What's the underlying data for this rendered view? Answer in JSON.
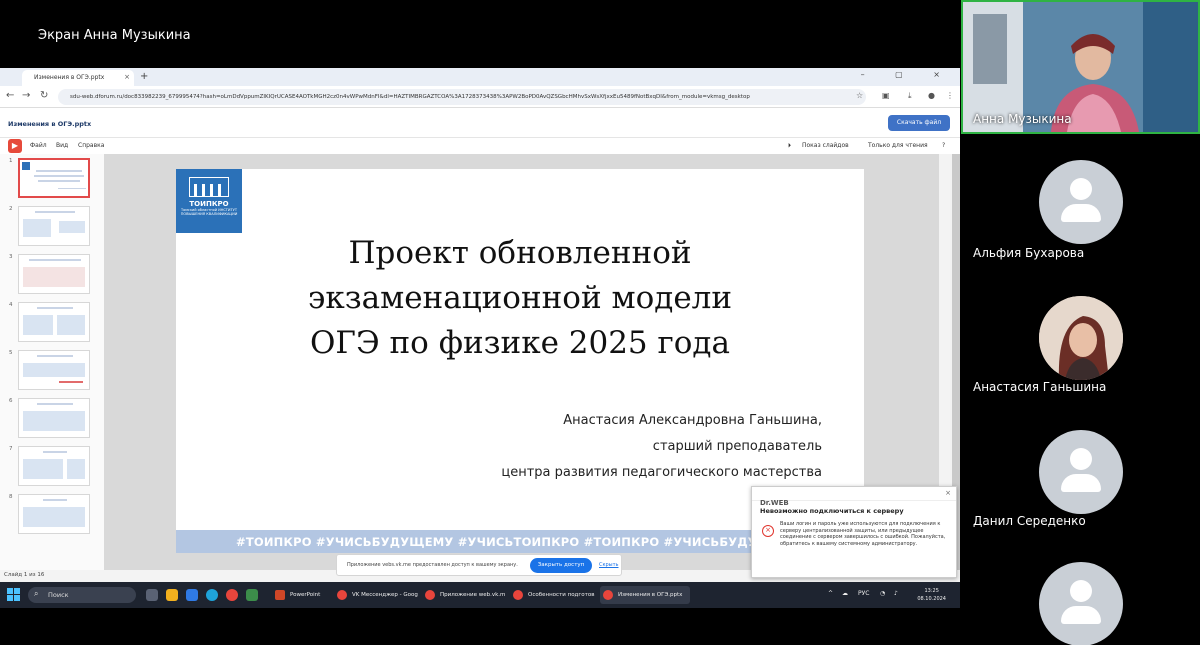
{
  "meeting": {
    "screen_title": "Экран Анна Музыкина"
  },
  "browser": {
    "tab_title": "Изменения в ОГЭ.pptx",
    "tab_close": "×",
    "new_tab": "+",
    "window_controls": "– ▢ ×",
    "url": "sdu-web.dforum.ru/doc833982239_679995474?hash=oLmDdVppumZIKIQrUCASE4AOTkMGH2cz0n4vWPwMdnFI&dl=HAZTIMBRGAZTCOA%3A1728373438%3APW2BoPD0AvQZSGbcHMhvSxWsXfjxxEu5489fNotBxqDI&from_module=vkmsg_desktop"
  },
  "doc": {
    "name": "Изменения в ОГЭ.pptx",
    "download_label": "Скачать файл",
    "menu": [
      "Файл",
      "Вид",
      "Справка"
    ],
    "slideshow_label": "Показ слайдов",
    "readonly_label": "Только для чтения",
    "status": "Слайд 1 из 16",
    "thumb_numbers": [
      "1",
      "2",
      "3",
      "4",
      "5",
      "6",
      "7",
      "8"
    ]
  },
  "slide": {
    "logo_title": "ТОИПКРО",
    "logo_sub": "Томский областной ИНСТИТУТ ПОВЫШЕНИЯ КВАЛИФИКАЦИИ",
    "title_lines": [
      "Проект обновленной",
      "экзаменационной модели",
      "ОГЭ по физике 2025 года"
    ],
    "author_lines": [
      "Анастасия Александровна Ганьшина,",
      "старший преподаватель",
      "центра развития педагогического мастерства"
    ],
    "hashtags": "#ТОИПКРО  #УЧИСЬБУДУЩЕМУ  #УЧИСЬТОИПКРО  #ТОИПКРО  #УЧИСЬБУДУЩЕМУ  #УЧИСЬ"
  },
  "share_banner": {
    "text": "Приложение vebs.vk.me предоставлен доступ к вашему экрану.",
    "button": "Закрыть доступ",
    "hide": "Скрыть"
  },
  "drweb": {
    "brand": "Dr.WEB",
    "title": "Невозможно подключиться к серверу",
    "text": "Ваши логин и пароль уже используются для подключения к серверу централизованной защиты, или предыдущее соединение с сервером завершилось с ошибкой. Пожалуйста, обратитесь к вашему системному администратору."
  },
  "taskbar": {
    "search": "Поиск",
    "apps": [
      "PowerPoint",
      "VK Мессенджер - Goog",
      "Приложение web.vk.m",
      "Особенности подготов",
      "Изменения в ОГЭ.pptx"
    ],
    "lang": "РУС",
    "time": "13:25",
    "date": "08.10.2024"
  },
  "participants": [
    {
      "name": "Анна Музыкина"
    },
    {
      "name": "Альфия Бухарова"
    },
    {
      "name": "Анастасия Ганьшина"
    },
    {
      "name": "Данил Середенко"
    }
  ],
  "colors": {
    "accent": "#3f72c6",
    "speaker_border": "#2fb344",
    "logo_blue": "#2b71b8",
    "hashtag_bar": "#b3c6e2"
  }
}
